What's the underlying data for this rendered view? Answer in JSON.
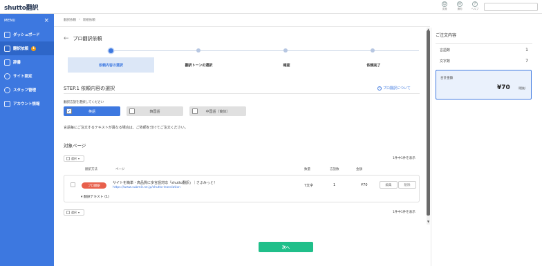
{
  "header": {
    "logo_text": "shutto",
    "logo_suffix": "翻訳",
    "icons": [
      {
        "icon": "support-icon",
        "label": "支援"
      },
      {
        "icon": "notification-icon",
        "label": "通知"
      },
      {
        "icon": "help-icon",
        "label": "ヘルプ"
      }
    ]
  },
  "sidebar": {
    "menu_label": "MENU",
    "items": [
      {
        "label": "ダッシュボード",
        "icon": "dashboard-icon"
      },
      {
        "label": "翻訳依頼",
        "icon": "translation-request-icon",
        "badge": "1"
      },
      {
        "label": "辞書",
        "icon": "dictionary-icon"
      },
      {
        "label": "サイト設定",
        "icon": "gear-icon"
      },
      {
        "label": "スタッフ管理",
        "icon": "staff-icon"
      },
      {
        "label": "アカウント情報",
        "icon": "account-icon"
      }
    ]
  },
  "breadcrumb": [
    "翻訳依頼",
    "新規依頼"
  ],
  "page": {
    "title": "プロ翻訳依頼",
    "steps": [
      "依頼内容の選択",
      "翻訳トーンの選択",
      "確認",
      "依頼完了"
    ],
    "section_title": "STEP.1 依頼内容の選択",
    "help_link": "プロ翻訳について",
    "lang_label": "翻訳言語を選択してください",
    "languages": [
      {
        "label": "英語",
        "checked": true
      },
      {
        "label": "韓国語",
        "checked": false
      },
      {
        "label": "中国語（簡体）",
        "checked": false
      }
    ],
    "note": "言語毎にご注文するテキストが異なる場合は、ご依頼を分けてご注文ください。",
    "target_title": "対象ページ",
    "bulk_select": "選択",
    "count_text": "1件中1件を表示",
    "table_headers": [
      "翻訳方法",
      "ページ",
      "数量",
      "言語数",
      "金額"
    ],
    "row": {
      "method": "プロ翻訳",
      "page_title": "サイトを簡単・高品質に多言語対応『shutto翻訳』｜さぶみっと！",
      "page_url": "https://www.submit.ne.jp/shutto-translation",
      "quantity": "7文字",
      "languages": "1",
      "price": "¥70",
      "edit": "編集",
      "delete": "削除",
      "translation_text": "翻訳テキスト (1)"
    },
    "next_button": "次へ"
  },
  "order": {
    "title": "ご注文内容",
    "rows": [
      {
        "label": "言語数",
        "value": "1"
      },
      {
        "label": "文字数",
        "value": "7"
      }
    ],
    "total_label": "合計金額",
    "total_value": "¥70",
    "total_tax": "（税抜）"
  },
  "colors": {
    "accent": "#3d78e0",
    "sidebar": "#3d78e0",
    "primary_action": "#20bf8a",
    "pro_badge": "#e8604c"
  }
}
